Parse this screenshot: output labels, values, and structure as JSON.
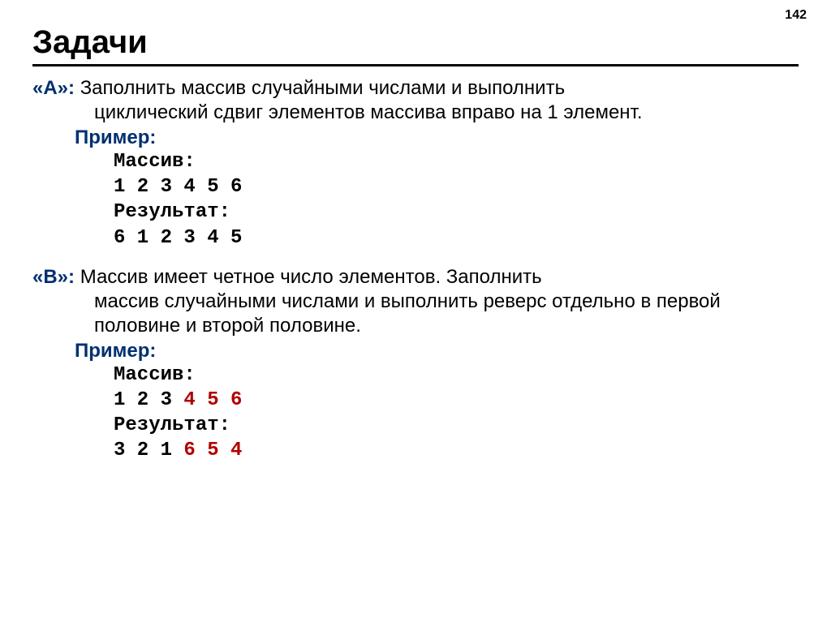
{
  "page_number": "142",
  "title": "Задачи",
  "task_a": {
    "label": "«A»: ",
    "desc_line1": "Заполнить массив случайными числами и выполнить",
    "desc_line2": "циклический сдвиг элементов массива вправо на 1 элемент.",
    "example_label": "Пример:",
    "array_label": "Массив:",
    "array_values": "1 2 3 4 5 6",
    "result_label": "Результат:",
    "result_values": "6 1 2 3 4 5"
  },
  "task_b": {
    "label": "«B»: ",
    "desc_line1": "Массив имеет четное число элементов. Заполнить",
    "desc_line2": "массив случайными числами и выполнить реверс отдельно в первой половине и второй половине.",
    "example_label": "Пример:",
    "array_label": "Массив:",
    "array_first": "1 2 3 ",
    "array_second": "4 5 6",
    "result_label": "Результат:",
    "result_first": "3 2 1 ",
    "result_second": "6 5 4"
  }
}
